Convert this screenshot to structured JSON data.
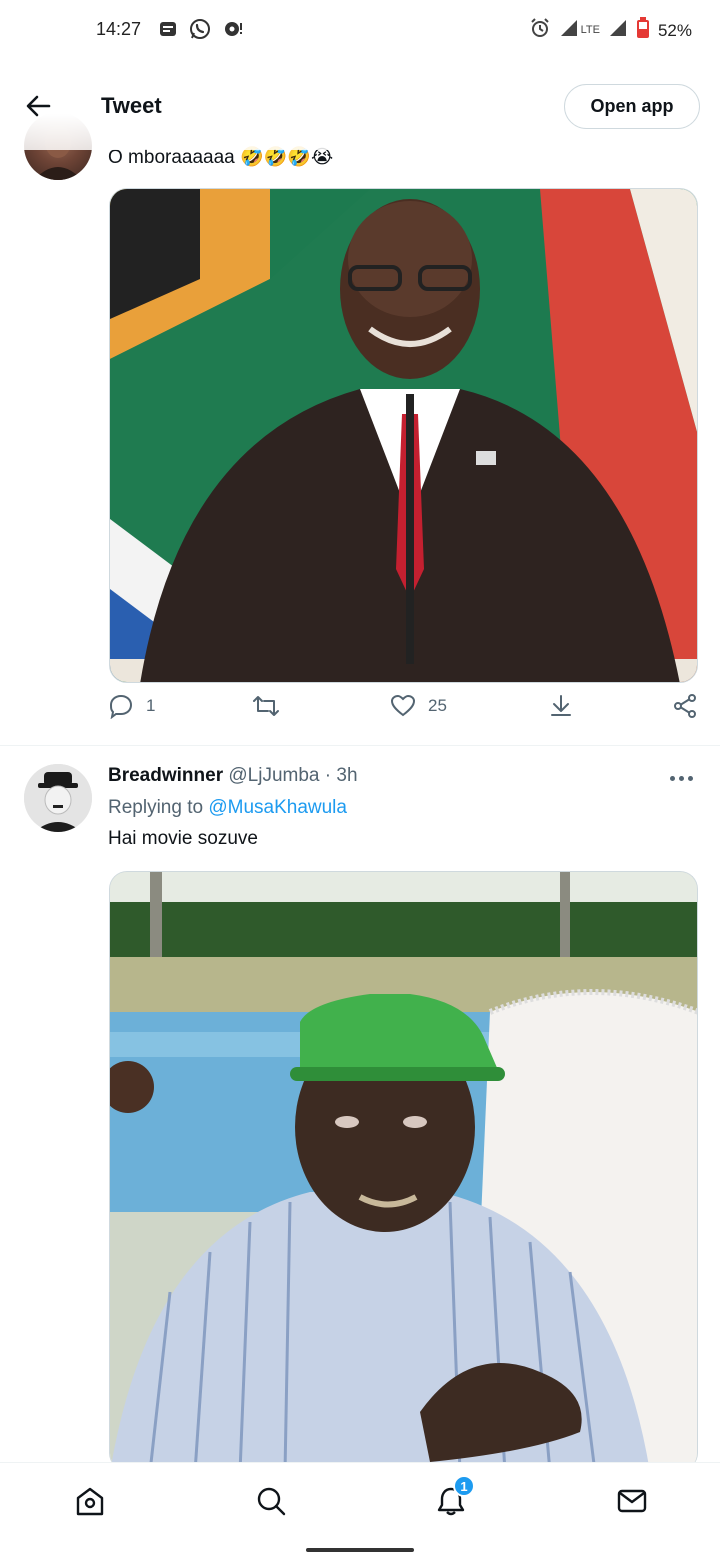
{
  "status_bar": {
    "time": "14:27",
    "network": "LTE",
    "battery": "52%",
    "left_icons": [
      "notification-icon",
      "whatsapp-icon",
      "chat-bubble-icon"
    ],
    "right_icons": [
      "alarm-icon",
      "signal-icon",
      "lte-icon",
      "signal-icon",
      "battery-icon"
    ]
  },
  "header": {
    "title": "Tweet",
    "open_app_label": "Open app"
  },
  "tweet1": {
    "text": "O mboraaaaaa 🤣🤣🤣😭",
    "actions": {
      "reply_count": "1",
      "retweet_count": "",
      "like_count": "25"
    }
  },
  "tweet2": {
    "author_name": "Breadwinner",
    "author_handle": "@LjJumba",
    "separator": "·",
    "time": "3h",
    "replying_prefix": "Replying to",
    "replying_to": "@MusaKhawula",
    "text": "Hai movie sozuve"
  },
  "bottom_nav": {
    "items": [
      "home-icon",
      "search-icon",
      "notifications-icon",
      "messages-icon"
    ],
    "notification_badge": "1"
  },
  "colors": {
    "accent": "#1d9bf0",
    "text": "#0f1419",
    "secondary": "#536471",
    "border": "#cfd9de"
  }
}
